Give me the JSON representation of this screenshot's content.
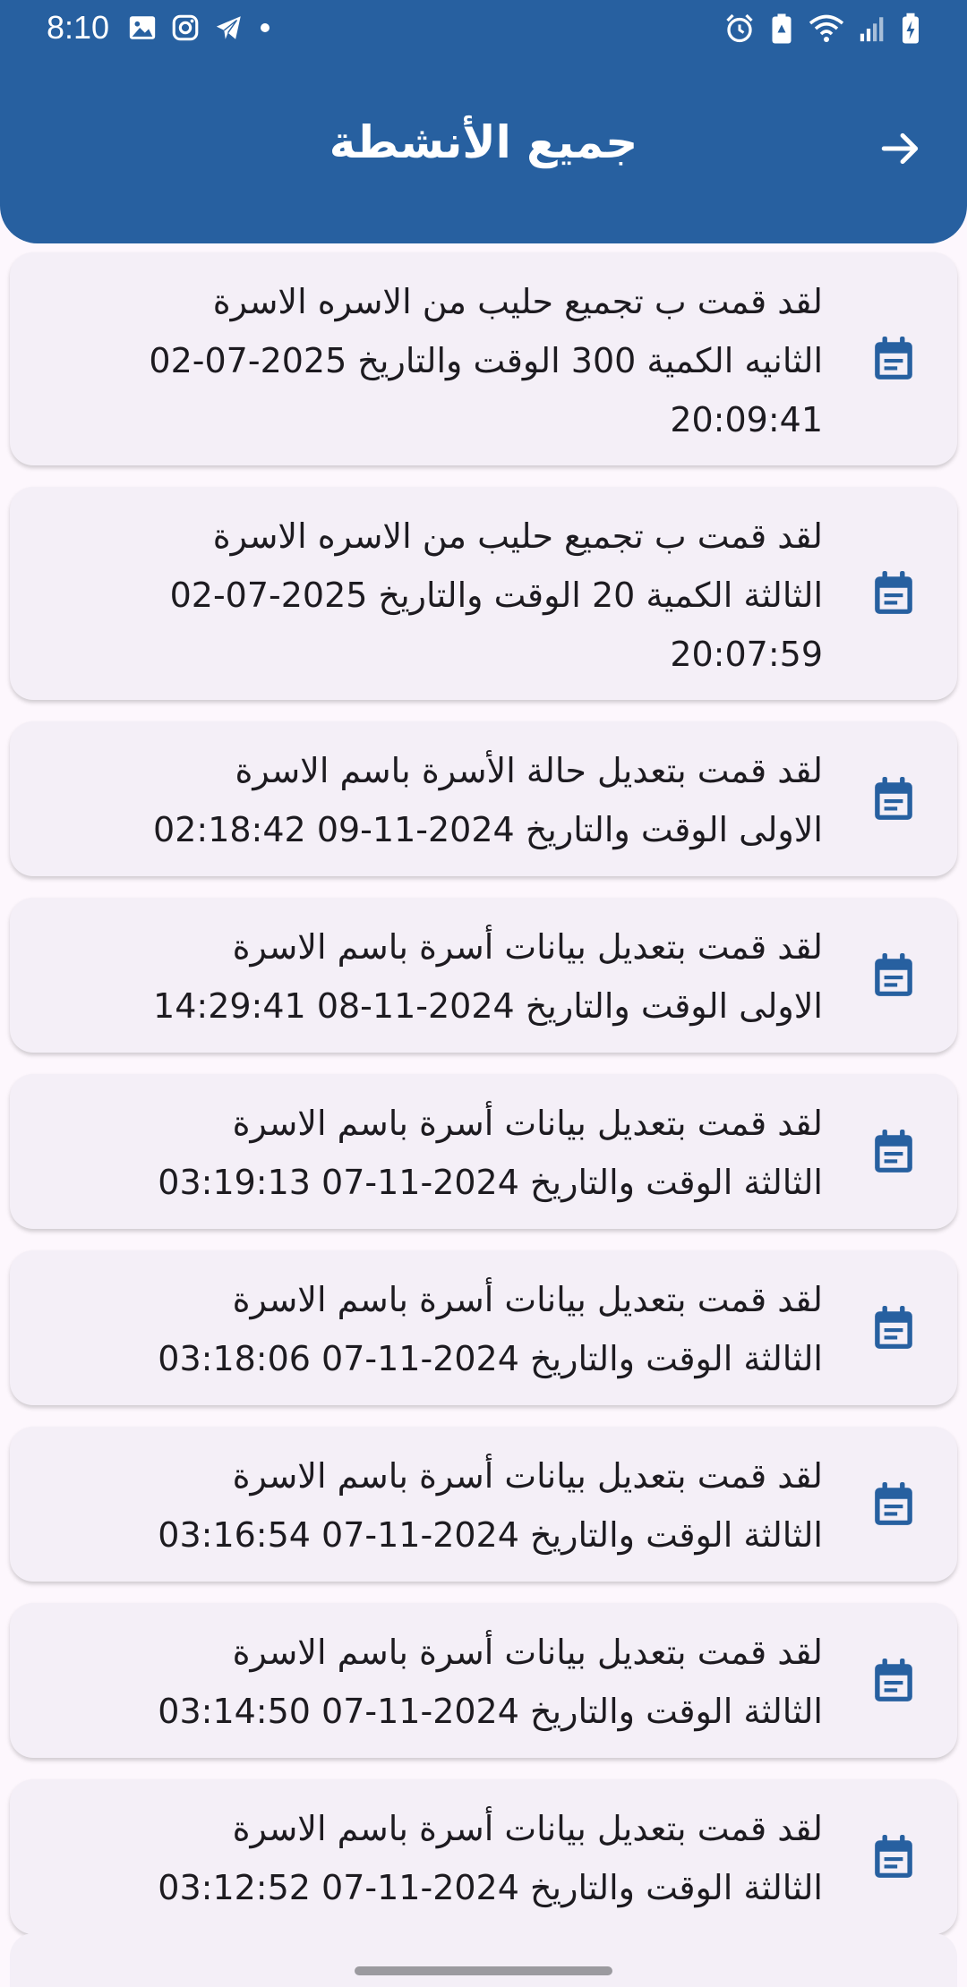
{
  "status_bar": {
    "time": "8:10",
    "left_icons": [
      "image-icon",
      "instagram-icon",
      "telegram-icon",
      "dot-icon"
    ],
    "right_icons": [
      "alarm-icon",
      "battery-saver-icon",
      "wifi-icon",
      "signal-icon",
      "battery-charging-icon"
    ]
  },
  "header": {
    "title": "جميع الأنشطة",
    "back_icon": "arrow-right-icon",
    "background_color": "#2760a0"
  },
  "activities": [
    {
      "text": "لقد قمت ب  تجميع حليب من الاسره الاسرة\nالثانيه الكمية 300 الوقت والتاريخ 2025-07-02\n20:09:41",
      "icon": "calendar-icon"
    },
    {
      "text": "لقد قمت ب  تجميع حليب من الاسره الاسرة\nالثالثة الكمية 20 الوقت والتاريخ 2025-07-02\n20:07:59",
      "icon": "calendar-icon"
    },
    {
      "text": "لقد قمت بتعديل حالة الأسرة باسم الاسرة\nالاولى الوقت والتاريخ 2024-11-09 02:18:42",
      "icon": "calendar-icon"
    },
    {
      "text": "لقد قمت بتعديل بيانات أسرة باسم الاسرة\nالاولى الوقت والتاريخ 2024-11-08 14:29:41",
      "icon": "calendar-icon"
    },
    {
      "text": "لقد قمت بتعديل بيانات أسرة باسم الاسرة\nالثالثة الوقت والتاريخ 2024-11-07 03:19:13",
      "icon": "calendar-icon"
    },
    {
      "text": "لقد قمت بتعديل بيانات أسرة باسم الاسرة\nالثالثة الوقت والتاريخ 2024-11-07 03:18:06",
      "icon": "calendar-icon"
    },
    {
      "text": "لقد قمت بتعديل بيانات أسرة باسم الاسرة\nالثالثة الوقت والتاريخ 2024-11-07 03:16:54",
      "icon": "calendar-icon"
    },
    {
      "text": "لقد قمت بتعديل بيانات أسرة باسم الاسرة\nالثالثة الوقت والتاريخ 2024-11-07 03:14:50",
      "icon": "calendar-icon"
    },
    {
      "text": "لقد قمت بتعديل بيانات أسرة باسم الاسرة\nالثالثة الوقت والتاريخ 2024-11-07 03:12:52",
      "icon": "calendar-icon"
    }
  ],
  "colors": {
    "primary": "#2760a0",
    "card_background": "#f4eff7",
    "page_background": "#fdf7fd",
    "text": "#1d1b20"
  }
}
